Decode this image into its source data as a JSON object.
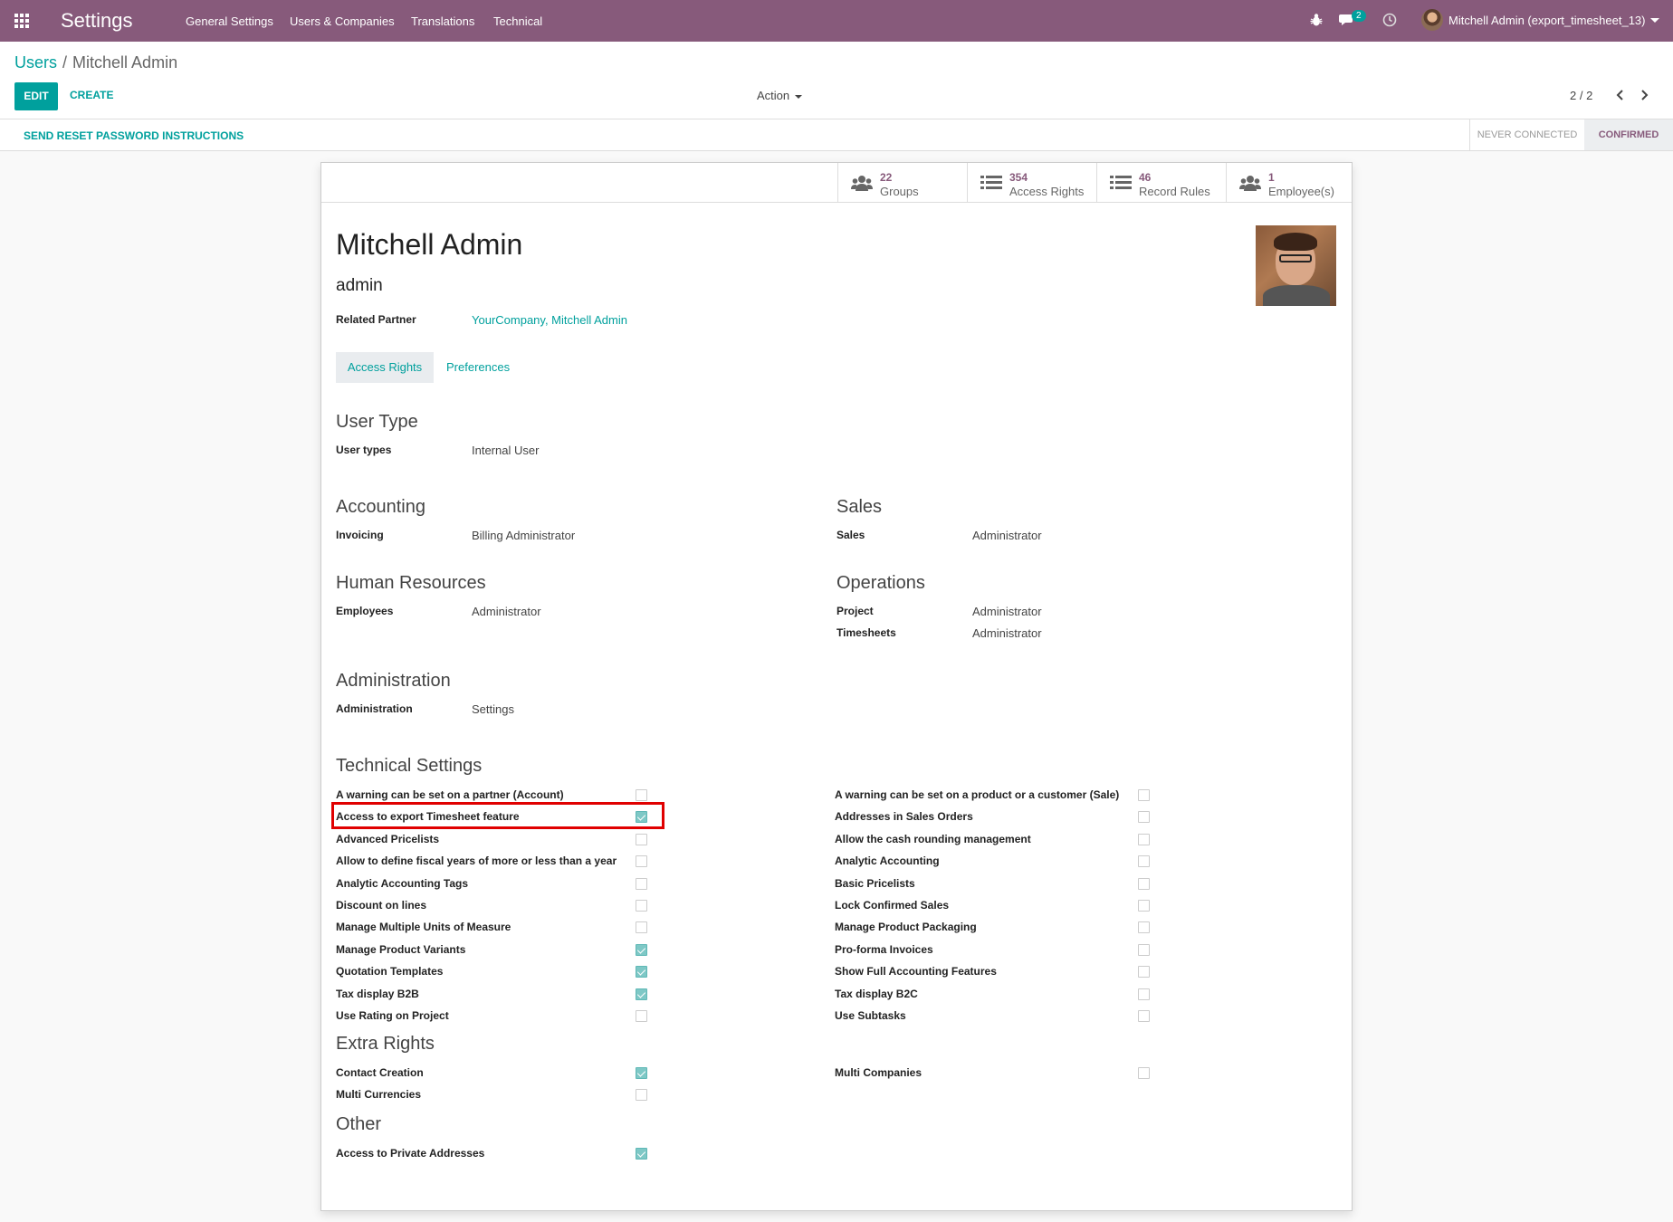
{
  "navbar": {
    "brand": "Settings",
    "menu": [
      "General Settings",
      "Users & Companies",
      "Translations",
      "Technical"
    ],
    "chat_badge": "2",
    "user": "Mitchell Admin (export_timesheet_13)",
    "bg_color": "#875a7b"
  },
  "control": {
    "breadcrumb_parent": "Users",
    "breadcrumb_sep": "/",
    "breadcrumb_current": "Mitchell Admin",
    "edit_label": "EDIT",
    "create_label": "CREATE",
    "action_label": "Action",
    "pager": "2 / 2"
  },
  "statusbar": {
    "reset_label": "SEND RESET PASSWORD INSTRUCTIONS",
    "stage_never": "NEVER CONNECTED",
    "stage_confirmed": "CONFIRMED"
  },
  "smart_buttons": [
    {
      "value": "22",
      "label": "Groups",
      "icon": "users-icon"
    },
    {
      "value": "354",
      "label": "Access Rights",
      "icon": "list-icon"
    },
    {
      "value": "46",
      "label": "Record Rules",
      "icon": "list-icon"
    },
    {
      "value": "1",
      "label": "Employee(s)",
      "icon": "users-icon"
    }
  ],
  "user": {
    "name": "Mitchell Admin",
    "login": "admin",
    "related_partner_label": "Related Partner",
    "related_partner_value": "YourCompany, Mitchell Admin"
  },
  "tabs": {
    "access_rights": "Access Rights",
    "preferences": "Preferences"
  },
  "user_type": {
    "title": "User Type",
    "label": "User types",
    "value": "Internal User"
  },
  "accounting": {
    "title": "Accounting",
    "label": "Invoicing",
    "value": "Billing Administrator"
  },
  "sales": {
    "title": "Sales",
    "label": "Sales",
    "value": "Administrator"
  },
  "hr": {
    "title": "Human Resources",
    "label": "Employees",
    "value": "Administrator"
  },
  "operations": {
    "title": "Operations",
    "project_label": "Project",
    "project_value": "Administrator",
    "timesheets_label": "Timesheets",
    "timesheets_value": "Administrator"
  },
  "administration": {
    "title": "Administration",
    "label": "Administration",
    "value": "Settings"
  },
  "technical": {
    "title": "Technical Settings",
    "left": [
      {
        "label": "A warning can be set on a partner (Account)",
        "checked": false
      },
      {
        "label": "Access to export Timesheet feature",
        "checked": true
      },
      {
        "label": "Advanced Pricelists",
        "checked": false
      },
      {
        "label": "Allow to define fiscal years of more or less than a year",
        "checked": false
      },
      {
        "label": "Analytic Accounting Tags",
        "checked": false
      },
      {
        "label": "Discount on lines",
        "checked": false
      },
      {
        "label": "Manage Multiple Units of Measure",
        "checked": false
      },
      {
        "label": "Manage Product Variants",
        "checked": true
      },
      {
        "label": "Quotation Templates",
        "checked": true
      },
      {
        "label": "Tax display B2B",
        "checked": true
      },
      {
        "label": "Use Rating on Project",
        "checked": false
      }
    ],
    "right": [
      {
        "label": "A warning can be set on a product or a customer (Sale)",
        "checked": false
      },
      {
        "label": "Addresses in Sales Orders",
        "checked": false
      },
      {
        "label": "Allow the cash rounding management",
        "checked": false
      },
      {
        "label": "Analytic Accounting",
        "checked": false
      },
      {
        "label": "Basic Pricelists",
        "checked": false
      },
      {
        "label": "Lock Confirmed Sales",
        "checked": false
      },
      {
        "label": "Manage Product Packaging",
        "checked": false
      },
      {
        "label": "Pro-forma Invoices",
        "checked": false
      },
      {
        "label": "Show Full Accounting Features",
        "checked": false
      },
      {
        "label": "Tax display B2C",
        "checked": false
      },
      {
        "label": "Use Subtasks",
        "checked": false
      }
    ]
  },
  "extra_rights": {
    "title": "Extra Rights",
    "left": [
      {
        "label": "Contact Creation",
        "checked": true
      },
      {
        "label": "Multi Currencies",
        "checked": false
      }
    ],
    "right": [
      {
        "label": "Multi Companies",
        "checked": false
      }
    ]
  },
  "other": {
    "title": "Other",
    "left": [
      {
        "label": "Access to Private Addresses",
        "checked": true
      }
    ]
  }
}
